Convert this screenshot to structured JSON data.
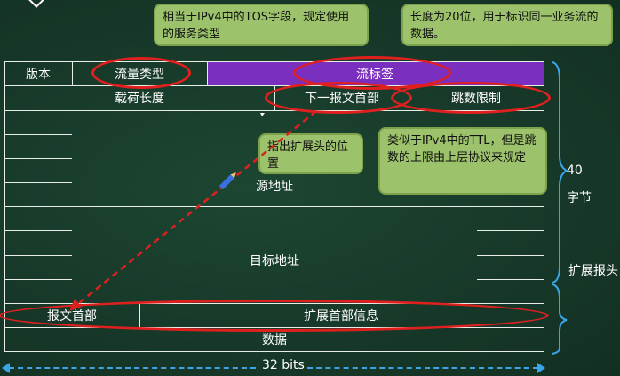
{
  "header_rows": {
    "row1": {
      "version": "版本",
      "traffic_class": "流量类型",
      "flow_label": "流标签"
    },
    "row2": {
      "payload_length": "载荷长度",
      "next_header": "下一报文首部",
      "hop_limit": "跳数限制"
    }
  },
  "fields": {
    "source_address": "源地址",
    "destination_address": "目标地址",
    "ext_header_first": "报文首部",
    "ext_header_info": "扩展首部信息",
    "data": "数据"
  },
  "callouts": {
    "traffic_class_note": "相当于IPv4中的TOS字段，规定使用的服务类型",
    "flow_label_note": "长度为20位，用于标识同一业务流的数据。",
    "next_header_note": "指出扩展头的位置",
    "hop_limit_note": "类似于IPv4中的TTL，但是跳数的上限由上层协议来规定"
  },
  "side_labels": {
    "header_size_number": "40",
    "header_size_unit": "字节",
    "extension_header": "扩展报头"
  },
  "width_label": "32 bits",
  "colors": {
    "background": "#173a2a",
    "flow_label_fill": "#7b2fbf",
    "callout_fill": "#9cc26b",
    "annotation_red": "#e0201f",
    "brace_blue": "#3aa6e8"
  }
}
